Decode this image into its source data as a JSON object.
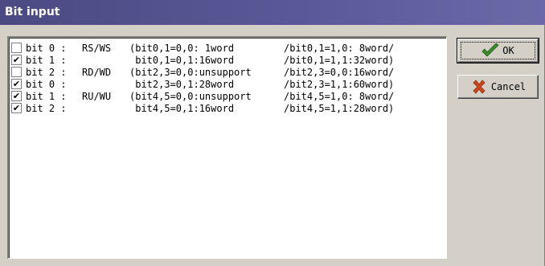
{
  "window": {
    "title": "Bit input"
  },
  "rows": [
    {
      "checked": false,
      "label": "bit 0 :",
      "signal": "RS/WS",
      "col_a": "(bit0,1=0,0: 1word",
      "col_b": "/bit0,1=1,0: 8word/"
    },
    {
      "checked": true,
      "label": "bit 1 :",
      "signal": "",
      "col_a": " bit0,1=0,1:16word",
      "col_b": "/bit0,1=1,1:32word)"
    },
    {
      "checked": false,
      "label": "bit 2 :",
      "signal": "RD/WD",
      "col_a": "(bit2,3=0,0:unsupport",
      "col_b": "/bit2,3=0,0:16word/"
    },
    {
      "checked": true,
      "label": "bit 0 :",
      "signal": "",
      "col_a": " bit2,3=0,1:28word",
      "col_b": "/bit2,3=1,1:60word)"
    },
    {
      "checked": true,
      "label": "bit 1 :",
      "signal": "RU/WU",
      "col_a": "(bit4,5=0,0:unsupport",
      "col_b": "/bit4,5=1,0: 8word/"
    },
    {
      "checked": true,
      "label": "bit 2 :",
      "signal": "",
      "col_a": " bit4,5=0,1:16word",
      "col_b": "/bit4,5=1,1:28word)"
    }
  ],
  "buttons": {
    "ok_label": "OK",
    "cancel_label": "Cancel"
  },
  "icons": {
    "ok": "checkmark-icon",
    "cancel": "x-icon"
  },
  "colors": {
    "titlebar": "#4b4a82",
    "ok_icon": "#3c8c2c",
    "cancel_icon": "#d2461e"
  }
}
